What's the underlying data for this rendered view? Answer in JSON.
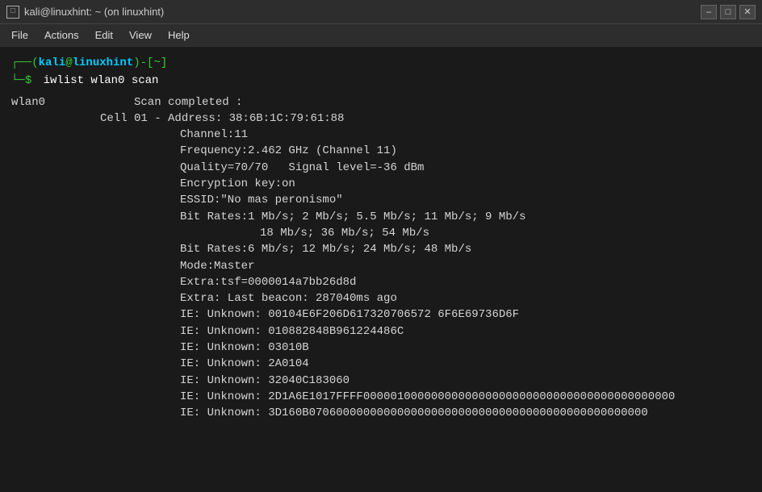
{
  "titlebar": {
    "icon": "□",
    "title": "kali@linuxhint: ~ (on linuxhint)",
    "minimize": "–",
    "maximize": "□",
    "close": "✕"
  },
  "menubar": {
    "items": [
      "File",
      "Actions",
      "Edit",
      "View",
      "Help"
    ]
  },
  "terminal": {
    "prompt": {
      "user": "kali",
      "at": "@",
      "host": "linuxhint",
      "separator": ")-[",
      "dir": "~",
      "bracket_close": "]",
      "dollar": "$",
      "command": "iwlist wlan0 scan"
    },
    "output": [
      {
        "indent": "iface",
        "text": "wlan0     Scan completed :"
      },
      {
        "indent": "cell",
        "text": "Cell 01 - Address: 38:6B:1C:79:61:88"
      },
      {
        "indent": "data",
        "text": "Channel:11"
      },
      {
        "indent": "data",
        "text": "Frequency:2.462 GHz (Channel 11)"
      },
      {
        "indent": "data",
        "text": "Quality=70/70   Signal level=-36 dBm"
      },
      {
        "indent": "data",
        "text": "Encryption key:on"
      },
      {
        "indent": "data",
        "text": "ESSID:\"No mas peronismo\""
      },
      {
        "indent": "data",
        "text": "Bit Rates:1 Mb/s; 2 Mb/s; 5.5 Mb/s; 11 Mb/s; 9 Mb/s"
      },
      {
        "indent": "data2",
        "text": "18 Mb/s; 36 Mb/s; 54 Mb/s"
      },
      {
        "indent": "data",
        "text": "Bit Rates:6 Mb/s; 12 Mb/s; 24 Mb/s; 48 Mb/s"
      },
      {
        "indent": "data",
        "text": "Mode:Master"
      },
      {
        "indent": "data",
        "text": "Extra:tsf=0000014a7bb26d8d"
      },
      {
        "indent": "data",
        "text": "Extra: Last beacon: 287040ms ago"
      },
      {
        "indent": "data",
        "text": "IE: Unknown: 00104E6F206D617320706572 6F6E69736D6F"
      },
      {
        "indent": "data",
        "text": "IE: Unknown: 010882848B961224486C"
      },
      {
        "indent": "data",
        "text": "IE: Unknown: 03010B"
      },
      {
        "indent": "data",
        "text": "IE: Unknown: 2A0104"
      },
      {
        "indent": "data",
        "text": "IE: Unknown: 32040C183060"
      },
      {
        "indent": "data",
        "text": "IE: Unknown: 2D1A6E1017FFFF000001000000000000000000000000000000000000"
      },
      {
        "indent": "data",
        "text": "IE: Unknown: 3D160B07060000000000000000000000000000000000000000000000"
      }
    ]
  }
}
